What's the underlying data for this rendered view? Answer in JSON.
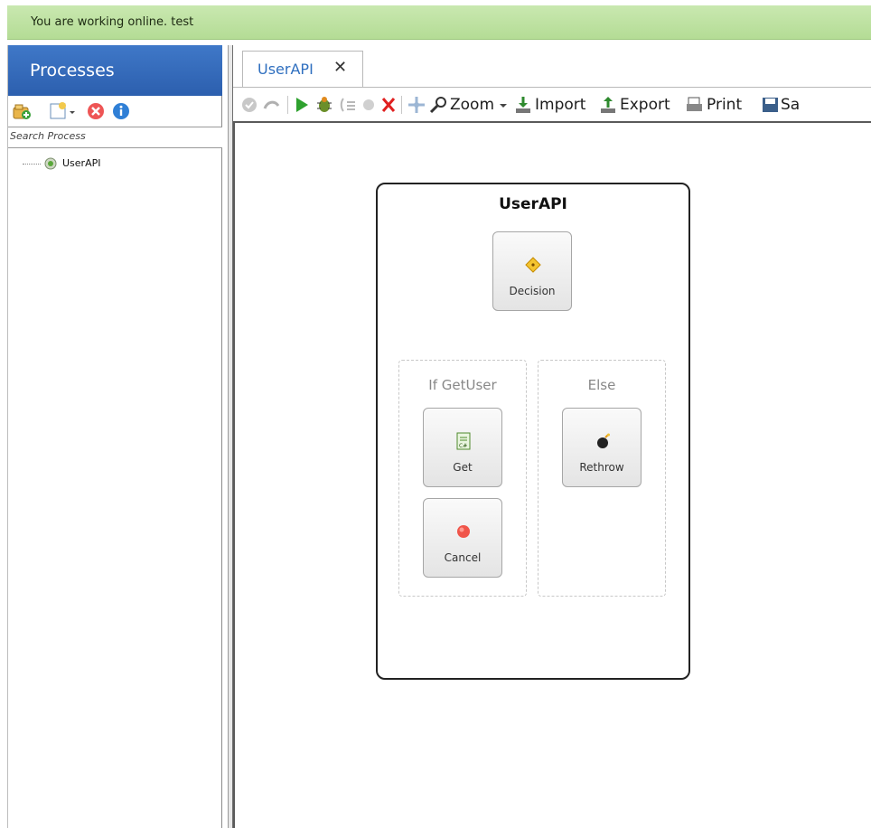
{
  "status": {
    "text": "You are working online. test"
  },
  "sidebar": {
    "title": "Processes",
    "search_placeholder": "Search Process",
    "tree": [
      {
        "label": "UserAPI"
      }
    ],
    "toolbar_icons": [
      "add-process-icon",
      "new-document-icon",
      "delete-icon",
      "info-icon"
    ]
  },
  "editor": {
    "tab": {
      "label": "UserAPI",
      "close": "✕"
    },
    "toolbar": {
      "zoom_label": "Zoom",
      "import_label": "Import",
      "export_label": "Export",
      "print_label": "Print",
      "save_label": "Sa"
    },
    "workflow": {
      "title": "UserAPI",
      "decision": {
        "label": "Decision"
      },
      "branches": [
        {
          "label": "If GetUser",
          "activities": [
            {
              "label": "Get"
            },
            {
              "label": "Cancel"
            }
          ]
        },
        {
          "label": "Else",
          "activities": [
            {
              "label": "Rethrow"
            }
          ]
        }
      ]
    }
  },
  "colors": {
    "status_bg": "#c9e8b0",
    "panel_header": "#3a70c0",
    "tab_text": "#2f6fbf"
  }
}
